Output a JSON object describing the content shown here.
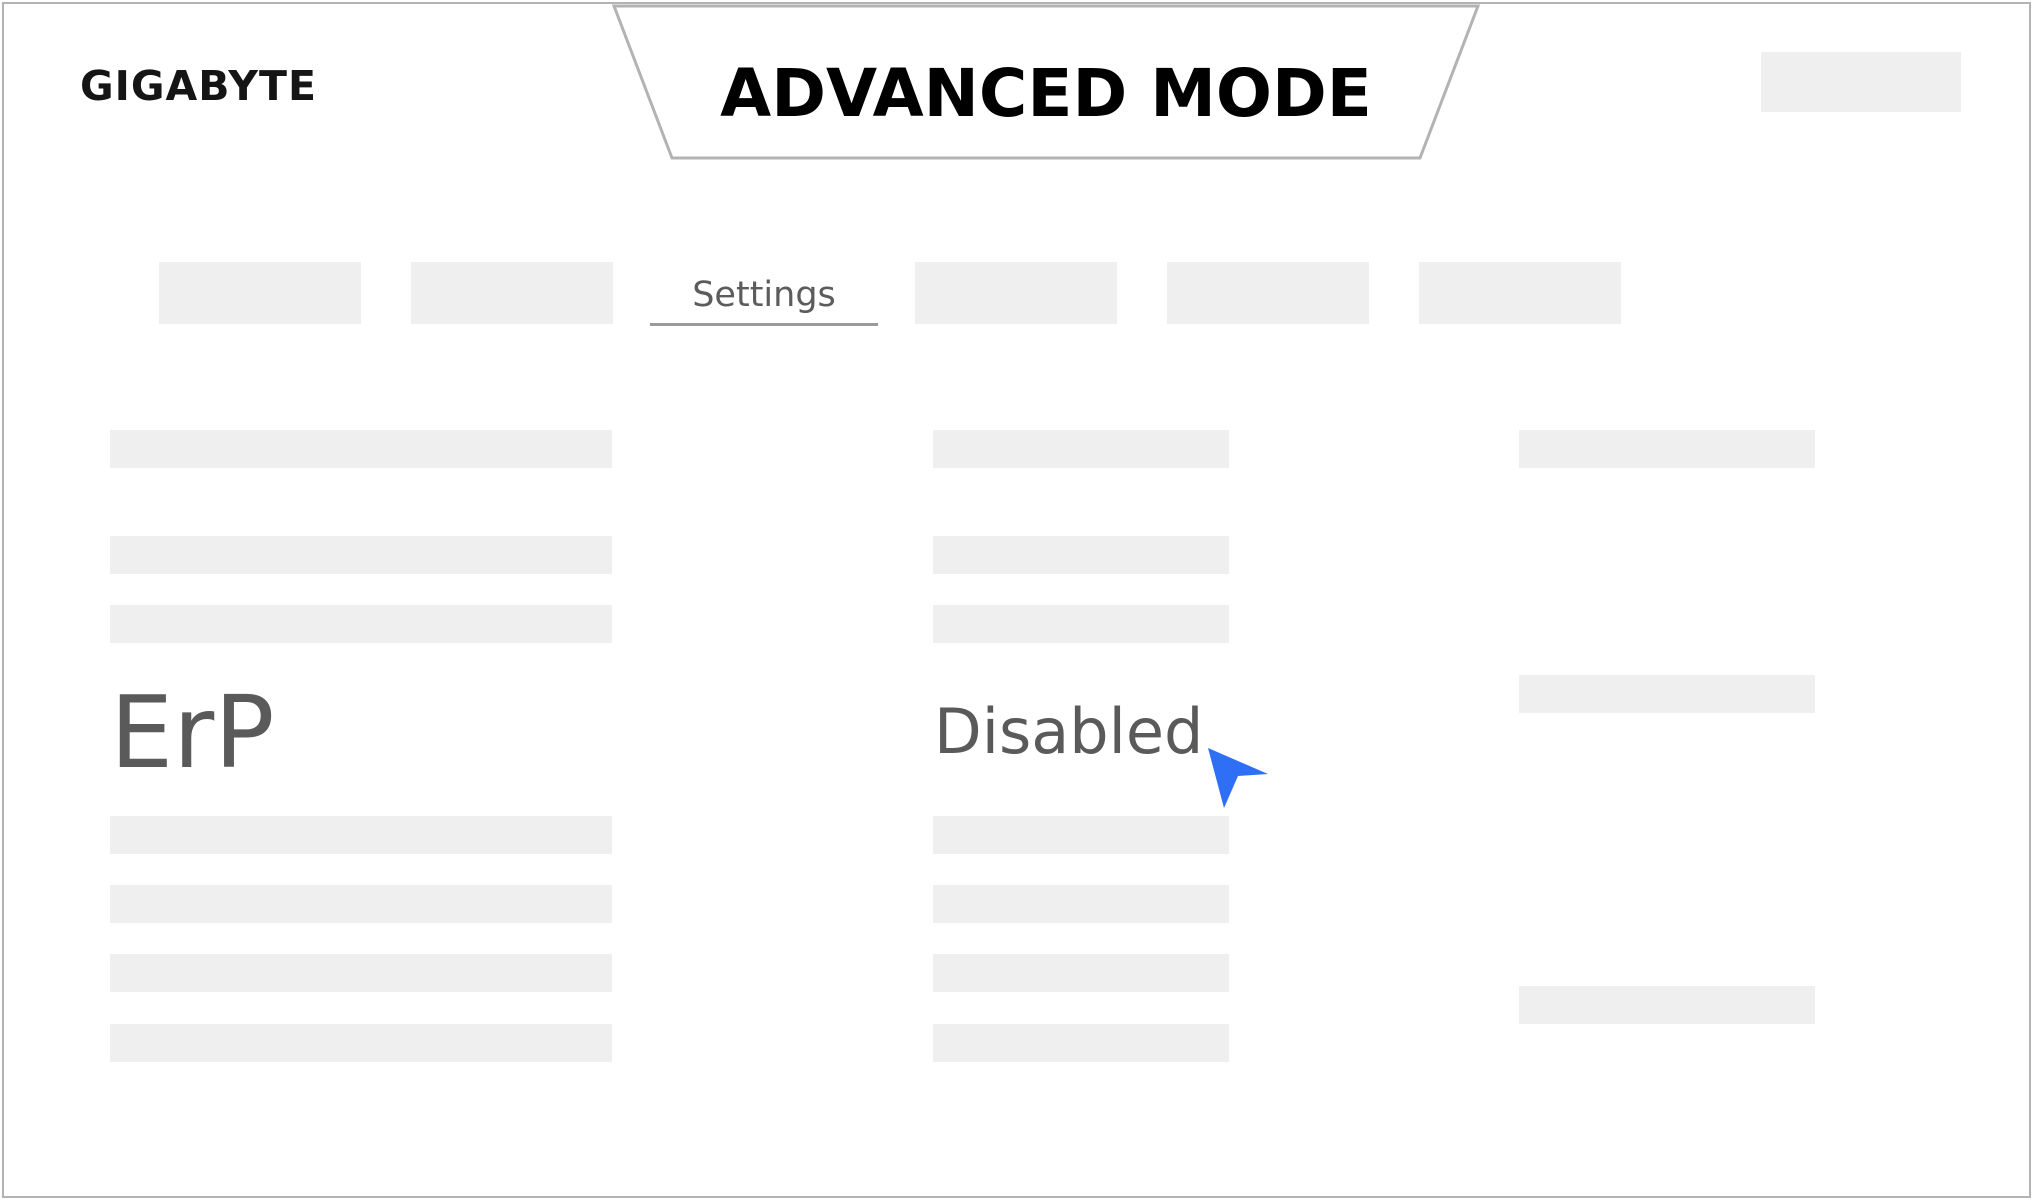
{
  "brand": {
    "logo_text": "GIGABYTE"
  },
  "header": {
    "mode_title": "ADVANCED MODE"
  },
  "tabs": {
    "active_label": "Settings"
  },
  "setting": {
    "name": "ErP",
    "value": "Disabled"
  },
  "cursor": {
    "icon": "pointer-arrow-icon",
    "color": "#2f6ff5"
  },
  "colors": {
    "placeholder": "#efefef",
    "text": "#5a5a5a",
    "title": "#000000"
  }
}
